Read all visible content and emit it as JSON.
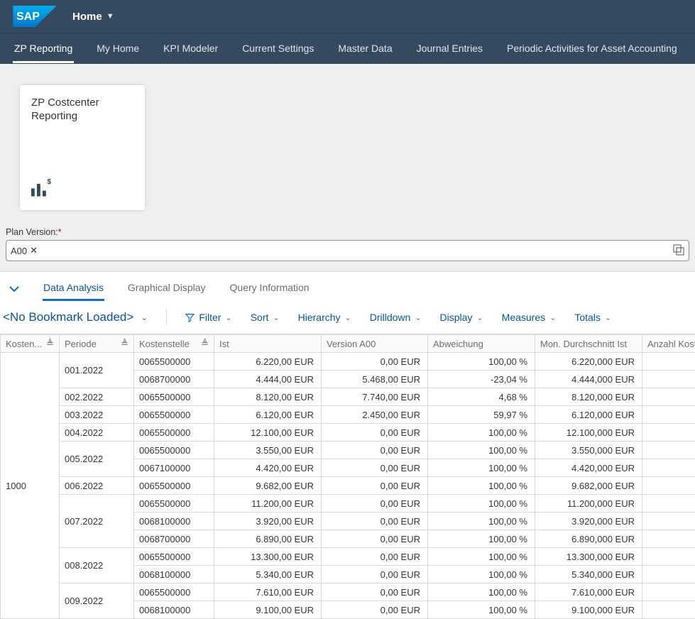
{
  "shell": {
    "home_label": "Home"
  },
  "nav": {
    "items": [
      {
        "label": "ZP Reporting",
        "active": true
      },
      {
        "label": "My Home"
      },
      {
        "label": "KPI Modeler"
      },
      {
        "label": "Current Settings"
      },
      {
        "label": "Master Data"
      },
      {
        "label": "Journal Entries"
      },
      {
        "label": "Periodic Activities for Asset Accounting"
      }
    ]
  },
  "tile": {
    "title": "ZP Costcenter Reporting"
  },
  "plan_version": {
    "label": "Plan Version:",
    "token": "A00"
  },
  "section_tabs": {
    "items": [
      {
        "label": "Data Analysis",
        "active": true
      },
      {
        "label": "Graphical Display"
      },
      {
        "label": "Query Information"
      }
    ]
  },
  "bm_text": "<No Bookmark Loaded>",
  "toolbar": {
    "filter": "Filter",
    "sort": "Sort",
    "hierarchy": "Hierarchy",
    "drilldown": "Drilldown",
    "display": "Display",
    "measures": "Measures",
    "totals": "Totals"
  },
  "columns": {
    "kostenrech": "Kosten...",
    "periode": "Periode",
    "kostenstelle": "Kostenstelle",
    "ist": "Ist",
    "version": "Version A00",
    "abweichung": "Abweichung",
    "mon": "Mon. Durchschnitt Ist",
    "anzahl": "Anzahl Koste"
  },
  "main_dim": "1000",
  "rows": [
    {
      "per": "001.2022",
      "ks": "0065500000",
      "ist": "6.220,00 EUR",
      "ver": "0,00 EUR",
      "abw": "100,00 %",
      "mon": "6.220,000 EUR",
      "per_span": 2
    },
    {
      "per": "",
      "ks": "0068700000",
      "ist": "4.444,00 EUR",
      "ver": "5.468,00 EUR",
      "abw": "-23,04 %",
      "mon": "4.444,000 EUR"
    },
    {
      "per": "002.2022",
      "ks": "0065500000",
      "ist": "8.120,00 EUR",
      "ver": "7.740,00 EUR",
      "abw": "4,68 %",
      "mon": "8.120,000 EUR",
      "per_span": 1
    },
    {
      "per": "003.2022",
      "ks": "0065500000",
      "ist": "6.120,00 EUR",
      "ver": "2.450,00 EUR",
      "abw": "59,97 %",
      "mon": "6.120,000 EUR",
      "per_span": 1
    },
    {
      "per": "004.2022",
      "ks": "0065500000",
      "ist": "12.100,00 EUR",
      "ver": "0,00 EUR",
      "abw": "100,00 %",
      "mon": "12.100,000 EUR",
      "per_span": 1
    },
    {
      "per": "005.2022",
      "ks": "0065500000",
      "ist": "3.550,00 EUR",
      "ver": "0,00 EUR",
      "abw": "100,00 %",
      "mon": "3.550,000 EUR",
      "per_span": 2
    },
    {
      "per": "",
      "ks": "0067100000",
      "ist": "4.420,00 EUR",
      "ver": "0,00 EUR",
      "abw": "100,00 %",
      "mon": "4.420,000 EUR"
    },
    {
      "per": "006.2022",
      "ks": "0065500000",
      "ist": "9.682,00 EUR",
      "ver": "0,00 EUR",
      "abw": "100,00 %",
      "mon": "9.682,000 EUR",
      "per_span": 1
    },
    {
      "per": "007.2022",
      "ks": "0065500000",
      "ist": "11.200,00 EUR",
      "ver": "0,00 EUR",
      "abw": "100,00 %",
      "mon": "11.200,000 EUR",
      "per_span": 3
    },
    {
      "per": "",
      "ks": "0068100000",
      "ist": "3.920,00 EUR",
      "ver": "0,00 EUR",
      "abw": "100,00 %",
      "mon": "3.920,000 EUR"
    },
    {
      "per": "",
      "ks": "0068700000",
      "ist": "6.890,00 EUR",
      "ver": "0,00 EUR",
      "abw": "100,00 %",
      "mon": "6.890,000 EUR"
    },
    {
      "per": "008.2022",
      "ks": "0065500000",
      "ist": "13.300,00 EUR",
      "ver": "0,00 EUR",
      "abw": "100,00 %",
      "mon": "13.300,000 EUR",
      "per_span": 2
    },
    {
      "per": "",
      "ks": "0068100000",
      "ist": "5.340,00 EUR",
      "ver": "0,00 EUR",
      "abw": "100,00 %",
      "mon": "5.340,000 EUR"
    },
    {
      "per": "009.2022",
      "ks": "0065500000",
      "ist": "7.610,00 EUR",
      "ver": "0,00 EUR",
      "abw": "100,00 %",
      "mon": "7.610,000 EUR",
      "per_span": 2
    },
    {
      "per": "",
      "ks": "0068100000",
      "ist": "9.100,00 EUR",
      "ver": "0,00 EUR",
      "abw": "100,00 %",
      "mon": "9.100,000 EUR"
    }
  ]
}
